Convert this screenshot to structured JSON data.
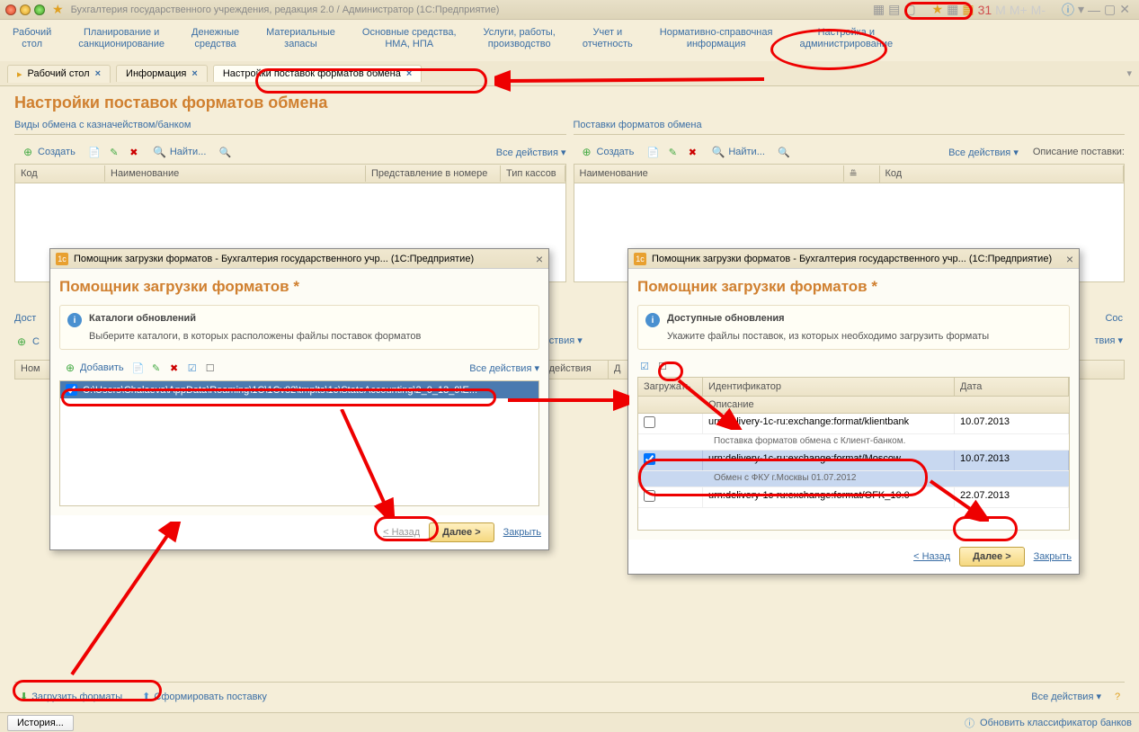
{
  "window_title": "Бухгалтерия государственного учреждения, редакция 2.0 / Администратор  (1С:Предприятие)",
  "menu": {
    "items": [
      "Рабочий\nстол",
      "Планирование и\nсанкционирование",
      "Денежные\nсредства",
      "Материальные\nзапасы",
      "Основные средства,\nНМА, НПА",
      "Услуги, работы,\nпроизводство",
      "Учет и\nотчетность",
      "Нормативно-справочная\nинформация",
      "Настройка и\nадминистрирование"
    ]
  },
  "tabs": [
    {
      "label": "Рабочий стол"
    },
    {
      "label": "Информация"
    },
    {
      "label": "Настройки поставок форматов обмена"
    }
  ],
  "page_heading": "Настройки поставок форматов обмена",
  "left_panel": {
    "title": "Виды обмена с казначейством/банком",
    "create": "Создать",
    "find": "Найти...",
    "vse": "Все действия ▾",
    "cols": [
      "Код",
      "Наименование",
      "Представление в номере",
      "Тип кассов"
    ]
  },
  "right_panel": {
    "title": "Поставки форматов обмена",
    "create": "Создать",
    "find": "Найти...",
    "vse": "Все действия ▾",
    "desc_label": "Описание поставки:",
    "cols": [
      "Наименование",
      "",
      "Код"
    ]
  },
  "dlg1": {
    "title": "Помощник загрузки форматов - Бухгалтерия государственного учр...  (1С:Предприятие)",
    "heading": "Помощник загрузки форматов *",
    "info_title": "Каталоги обновлений",
    "info_text": "Выберите каталоги, в которых расположены файлы поставок форматов",
    "add": "Добавить",
    "vse": "Все действия ▾",
    "path": "C:\\Users\\Chalaeva\\AppData\\Roaming\\1C\\1Cv82\\tmplts\\1c\\StateAccounting\\2_0_13_9\\E...",
    "back": "< Назад",
    "next": "Далее >",
    "close": "Закрыть"
  },
  "dlg2": {
    "title": "Помощник загрузки форматов - Бухгалтерия государственного учр...  (1С:Предприятие)",
    "heading": "Помощник загрузки форматов *",
    "info_title": "Доступные обновления",
    "info_text": "Укажите файлы поставок, из которых необходимо загрузить форматы",
    "cols": {
      "load": "Загружать",
      "id": "Идентификатор",
      "date": "Дата",
      "desc": "Описание"
    },
    "rows": [
      {
        "checked": false,
        "id": "urn:delivery-1c-ru:exchange:format/klientbank",
        "date": "10.07.2013",
        "desc": "Поставка форматов обмена с Клиент-банком."
      },
      {
        "checked": true,
        "id": "urn:delivery-1c-ru:exchange:format/Moscow",
        "date": "10.07.2013",
        "desc": "Обмен с ФКУ г.Москвы 01.07.2012"
      },
      {
        "checked": false,
        "id": "urn:delivery-1c-ru:exchange:format/OFK_10.0",
        "date": "22.07.2013",
        "desc": ""
      }
    ],
    "back": "< Назад",
    "next": "Далее >",
    "close": "Закрыть"
  },
  "mid": {
    "vse": "Все действия ▾",
    "dost": "Дост",
    "sos": "Сос",
    "nom": "Ном",
    "nach": "чало действия",
    "d": "Д"
  },
  "bottom": {
    "load": "Загрузить форматы",
    "form": "Сформировать поставку",
    "vse": "Все действия ▾"
  },
  "status": {
    "history": "История...",
    "refresh": "Обновить классификатор банков"
  }
}
